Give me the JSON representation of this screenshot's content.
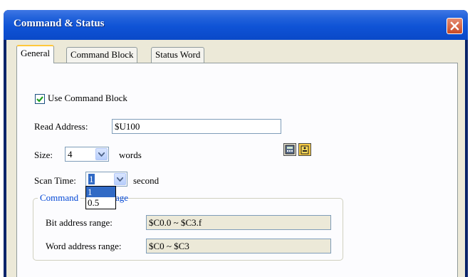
{
  "window": {
    "title": "Command & Status"
  },
  "tabs": [
    {
      "label": "General",
      "active": true
    },
    {
      "label": "Command Block",
      "active": false
    },
    {
      "label": "Status Word",
      "active": false
    }
  ],
  "general": {
    "use_command_block": {
      "label": "Use Command Block",
      "checked": true
    },
    "read_address": {
      "label": "Read Address:",
      "value": "$U100"
    },
    "size": {
      "label": "Size:",
      "value": "4",
      "unit": "words"
    },
    "scan_time": {
      "label": "Scan Time:",
      "value": "1",
      "unit": "second",
      "options": [
        "1",
        "0.5"
      ],
      "highlighted": "1"
    },
    "group": {
      "title_visible_left": "Command",
      "title_visible_right": "age",
      "bit_range": {
        "label": "Bit address range:",
        "value": "$C0.0 ~ $C3.f"
      },
      "word_range": {
        "label": "Word address range:",
        "value": "$C0 ~ $C3"
      }
    }
  },
  "icons": [
    "calculator-icon",
    "tag-icon",
    "close-icon",
    "checkmark-icon",
    "dropdown-arrow-icon"
  ],
  "colors": {
    "title_bar": "#0f53d6",
    "group_title": "#0046d5",
    "selection": "#316ac5",
    "tab_highlight": "#ffc83c"
  }
}
